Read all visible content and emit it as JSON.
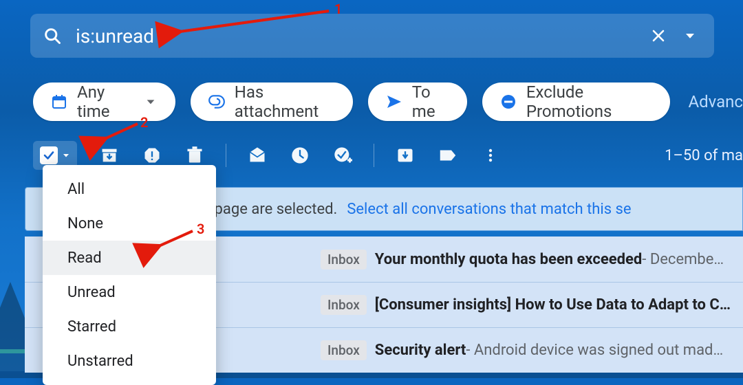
{
  "search": {
    "value": "is:unread"
  },
  "chips": {
    "anytime": "Any time",
    "attachment": "Has attachment",
    "tome": "To me",
    "exclude": "Exclude Promotions",
    "advanced": "Advanc"
  },
  "toolbar": {
    "count": "1–50 of ma"
  },
  "banner": {
    "text_suffix": "ons on this page are selected.",
    "link": "Select all conversations that match this se"
  },
  "dropdown": {
    "items": [
      "All",
      "None",
      "Read",
      "Unread",
      "Starred",
      "Unstarred"
    ]
  },
  "mails": {
    "inbox_label": "Inbox",
    "rows": [
      {
        "subject": "Your monthly quota has been exceeded",
        "snippet": " - Decembe…"
      },
      {
        "subject": "[Consumer insights] How to Use Data to Adapt to C…",
        "snippet": ""
      },
      {
        "subject": "Security alert",
        "snippet": " - Android device was signed out mad…"
      }
    ]
  },
  "annotations": {
    "n1": "1",
    "n2": "2",
    "n3": "3"
  }
}
